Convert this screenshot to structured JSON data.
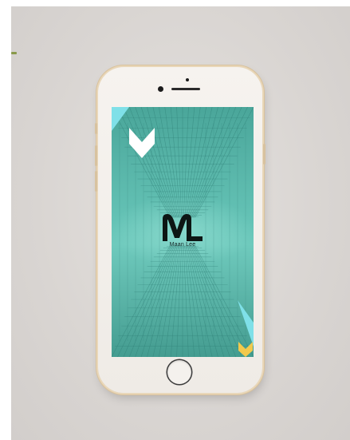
{
  "app": {
    "brand_initials": "ML",
    "brand_name": "Maan Lee"
  },
  "colors": {
    "screen_teal": "#57b6a8",
    "screen_teal_light": "#7fd3c8",
    "chevron_white": "#ffffff",
    "chevron_cyan": "#7fe0e8",
    "chevron_yellow": "#f2c94c",
    "phone_body": "#f3efea",
    "phone_trim": "#d9c29c",
    "backdrop": "#d9d5d2"
  },
  "icons": {
    "top_left": "chevron-down-icon",
    "bottom_right": "chevron-down-icon",
    "corner_triangles": "triangle-icon"
  }
}
